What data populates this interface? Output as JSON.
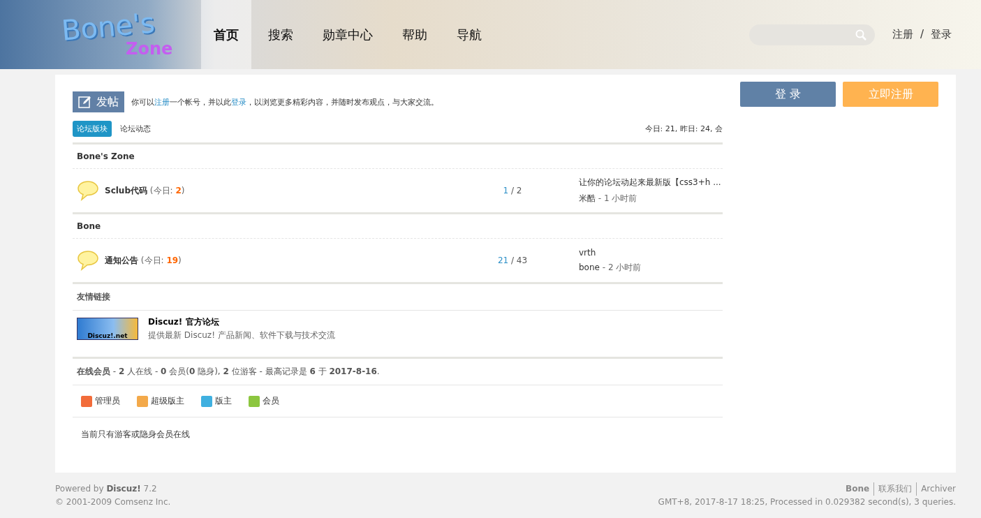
{
  "header": {
    "logo": {
      "line1": "Bone's",
      "line2": "Zone"
    },
    "nav": [
      {
        "label": "首页",
        "selected": true
      },
      {
        "label": "搜索",
        "selected": false
      },
      {
        "label": "勋章中心",
        "selected": false
      },
      {
        "label": "帮助",
        "selected": false
      },
      {
        "label": "导航",
        "selected": false
      }
    ],
    "search": {
      "kind": "pill"
    },
    "auth": [
      "注册",
      "/",
      "登录"
    ]
  },
  "post_button": "发帖",
  "notice": [
    {
      "kind": "text",
      "text": "你可以"
    },
    {
      "kind": "link",
      "text": "注册"
    },
    {
      "kind": "text",
      "text": "一个帐号，并以此"
    },
    {
      "kind": "link",
      "text": "登录"
    },
    {
      "kind": "text",
      "text": "，以浏览更多精彩内容，并随时发布观点，与大家交流。"
    }
  ],
  "tabs": [
    {
      "label": "论坛版块",
      "selected": true
    },
    {
      "label": "论坛动态",
      "selected": false
    }
  ],
  "stats": "今日: 21, 昨日: 24, 会",
  "categories": [
    {
      "title": "Bone's Zone",
      "forums": [
        {
          "name": "Sclub代码",
          "today": "(今日: **2**)",
          "threads": "1",
          "posts": "/ 2",
          "last_title": "让你的论坛动起来最新版【css3+h ...",
          "last_author": "米酷",
          "last_time": "- 1 小时前"
        }
      ]
    },
    {
      "title": "Bone",
      "forums": [
        {
          "name": "通知公告",
          "today": "(今日: **19**)",
          "threads": "21",
          "posts": "/ 43",
          "last_title": "vrth",
          "last_author": "bone",
          "last_time": "- 2 小时前"
        }
      ]
    }
  ],
  "links": {
    "title": "友情链接",
    "items": [
      {
        "logo_text": "Discuz!.net",
        "name": "Discuz! 官方论坛",
        "desc": "提供最新 Discuz! 产品新闻、软件下载与技术交流"
      }
    ]
  },
  "online": {
    "summary": "**在线会员** - **2** 人在线 - **0** 会员(**0** 隐身), **2** 位游客 - 最高记录是 **6** 于 **2017-8-16**.",
    "legend": [
      {
        "label": "管理员",
        "color": "#f26c3a"
      },
      {
        "label": "超级版主",
        "color": "#f3a94a"
      },
      {
        "label": "版主",
        "color": "#3fb0e0"
      },
      {
        "label": "会员",
        "color": "#8cc63f"
      }
    ],
    "note": "当前只有游客或隐身会员在线"
  },
  "side": {
    "login": "登 录",
    "register": "立即注册"
  },
  "footer": {
    "powered": "Powered by **Discuz!** 7.2",
    "copyright": "© 2001-2009 Comsenz Inc.",
    "links": [
      "Bone",
      "联系我们",
      "Archiver"
    ],
    "info": "GMT+8, 2017-8-17 18:25, Processed in 0.029382 second(s), 3 queries."
  }
}
